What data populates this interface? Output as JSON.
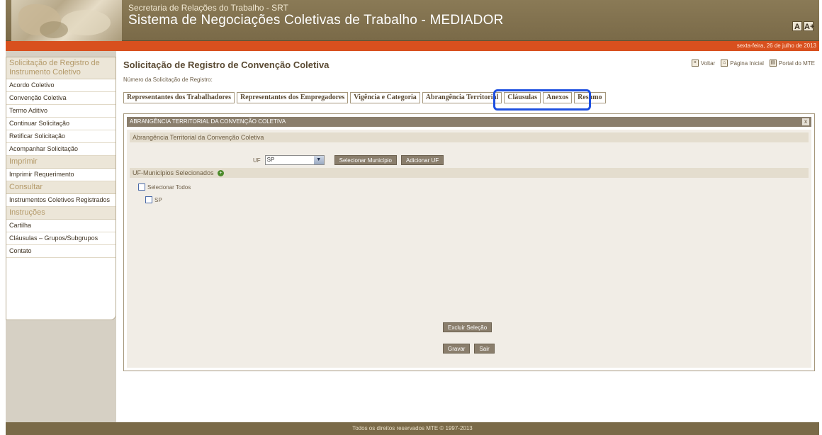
{
  "header": {
    "subtitle": "Secretaria de Relações do Trabalho - SRT",
    "title": "Sistema de Negociações Coletivas de Trabalho - MEDIADOR",
    "font_small": "A",
    "font_large": "A+"
  },
  "date_bar": {
    "text": "sexta-feira, 26 de julho de 2013"
  },
  "sidebar": {
    "sections": [
      {
        "title": "Solicitação de Registro de Instrumento Coletivo",
        "items": [
          "Acordo Coletivo",
          "Convenção Coletiva",
          "Termo Aditivo",
          "Continuar Solicitação",
          "Retificar Solicitação",
          "Acompanhar Solicitação"
        ]
      },
      {
        "title": "Imprimir",
        "items": [
          "Imprimir Requerimento"
        ]
      },
      {
        "title": "Consultar",
        "items": [
          "Instrumentos Coletivos Registrados"
        ]
      },
      {
        "title": "Instruções",
        "items": [
          "Cartilha",
          "Cláusulas – Grupos/Subgrupos",
          "Contato"
        ]
      }
    ]
  },
  "main": {
    "page_title": "Solicitação de Registro de Convenção Coletiva",
    "request_number_label": "Número da Solicitação de Registro:",
    "top_links": {
      "back": "Voltar",
      "home": "Página Inicial",
      "portal": "Portal do MTE"
    },
    "tabs": [
      {
        "label": "Representantes dos Trabalhadores",
        "active": false
      },
      {
        "label": "Representantes dos Empregadores",
        "active": false
      },
      {
        "label": "Vigência e Categoria",
        "active": false
      },
      {
        "label": "Abrangência Territorial",
        "active": true
      },
      {
        "label": "Cláusulas",
        "active": false
      },
      {
        "label": "Anexos",
        "active": false
      },
      {
        "label": "Resumo",
        "active": false
      }
    ],
    "panel": {
      "header": "Abrangência Territorial da Convenção Coletiva",
      "close_icon": "x",
      "section1_title": "Abrangência Territorial da Convenção Coletiva",
      "uf_label": "UF",
      "uf_value": "SP",
      "btn_select_municipio": "Selecionar Município",
      "btn_add_uf": "Adicionar UF",
      "section2_title": "UF-Municípios Selecionados",
      "select_all_label": "Selecionar Todos",
      "items": [
        "SP"
      ],
      "btn_excluir": "Excluir Seleção",
      "btn_gravar": "Gravar",
      "btn_sair": "Sair"
    }
  },
  "footer": {
    "text": "Todos os direitos reservados MTE © 1997-2013"
  },
  "colors": {
    "header_bg": "#7a6a48",
    "date_bar": "#d8501e",
    "highlight": "#1d4fe0",
    "panel_head": "#8a7e6c"
  }
}
